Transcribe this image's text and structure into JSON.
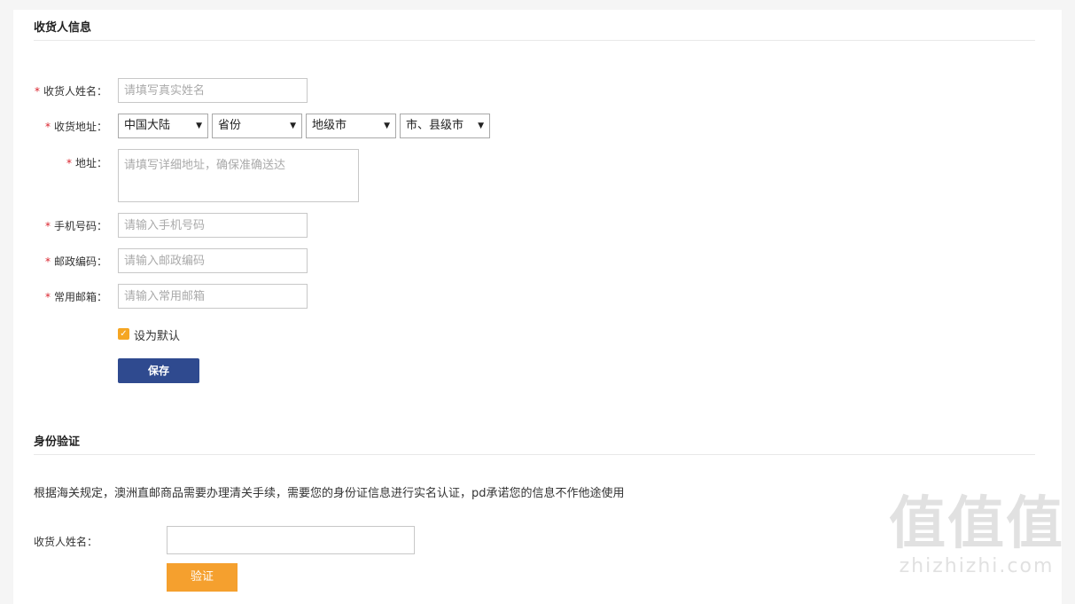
{
  "consignee": {
    "section_title": "收货人信息",
    "name_label": "收货人姓名：",
    "name_placeholder": "请填写真实姓名",
    "region_label": "收货地址：",
    "region_selects": [
      "中国大陆",
      "省份",
      "地级市",
      "市、县级市"
    ],
    "address_label": "地址：",
    "address_placeholder": "请填写详细地址，确保准确送达",
    "phone_label": "手机号码：",
    "phone_placeholder": "请输入手机号码",
    "postal_label": "邮政编码：",
    "postal_placeholder": "请输入邮政编码",
    "email_label": "常用邮箱：",
    "email_placeholder": "请输入常用邮箱",
    "default_label": "设为默认",
    "default_checked": true,
    "save_label": "保存",
    "required_mark": "*"
  },
  "identity": {
    "section_title": "身份验证",
    "description": "根据海关规定，澳洲直邮商品需要办理清关手续，需要您的身份证信息进行实名认证，pd承诺您的信息不作他途使用",
    "name_label": "收货人姓名：",
    "name_value": "",
    "verify_label": "验证"
  },
  "watermark": {
    "glyphs": "值值值",
    "domain": "zhizhizhi.com"
  },
  "colors": {
    "primary_button": "#2f4a8f",
    "verify_button": "#f5a02e",
    "required": "#d9232d",
    "checkbox": "#f5a623"
  }
}
